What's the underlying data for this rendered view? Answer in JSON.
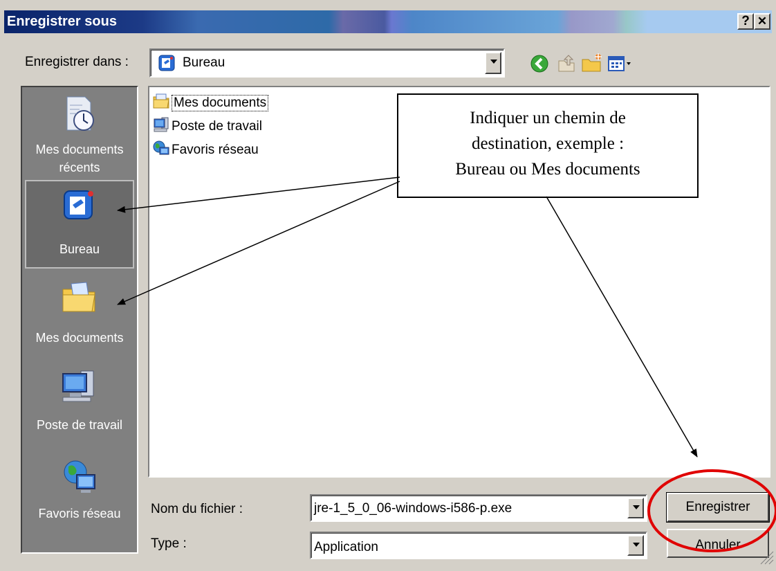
{
  "window": {
    "title": "Enregistrer sous",
    "help_button": "?",
    "close_button": "✕"
  },
  "toolbar": {
    "save_in_label": "Enregistrer dans :",
    "location_value": "Bureau"
  },
  "places": [
    {
      "label": "Mes documents récents",
      "icon": "recent-documents-icon"
    },
    {
      "label": "Bureau",
      "icon": "desktop-icon"
    },
    {
      "label": "Mes documents",
      "icon": "my-documents-icon"
    },
    {
      "label": "Poste de travail",
      "icon": "my-computer-icon"
    },
    {
      "label": "Favoris réseau",
      "icon": "network-places-icon"
    }
  ],
  "files": [
    {
      "name": "Mes documents",
      "icon": "my-documents-icon"
    },
    {
      "name": "Poste de travail",
      "icon": "my-computer-icon"
    },
    {
      "name": "Favoris réseau",
      "icon": "network-places-icon"
    }
  ],
  "form": {
    "filename_label": "Nom du fichier :",
    "filename_value": "jre-1_5_0_06-windows-i586-p.exe",
    "type_label": "Type :",
    "type_value": "Application"
  },
  "buttons": {
    "save": "Enregistrer",
    "cancel": "Annuler"
  },
  "annotation": {
    "line1": "Indiquer un chemin de",
    "line2": "destination, exemple :",
    "line3": "Bureau ou Mes documents"
  },
  "colors": {
    "title_bar_start": "#0a246a",
    "highlight_circle": "#e00000",
    "places_bar": "#808080"
  }
}
